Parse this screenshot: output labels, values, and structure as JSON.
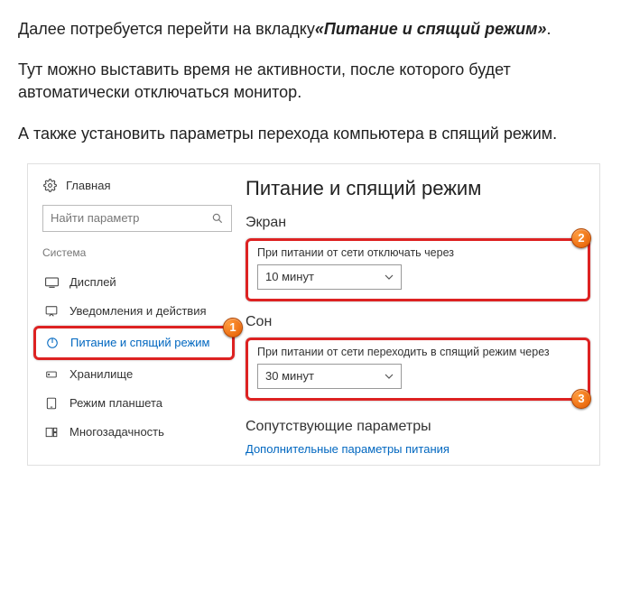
{
  "intro": {
    "p1_a": "Далее потребуется перейти на вкладку",
    "p1_b": "«Питание и спящий режим»",
    "p1_c": ".",
    "p2": "Тут можно выставить время не активности, после которого будет автоматически отключаться монитор.",
    "p3": "А также установить параметры перехода компьютера в спящий режим."
  },
  "sidebar": {
    "home": "Главная",
    "search_placeholder": "Найти параметр",
    "category": "Система",
    "items": [
      {
        "label": "Дисплей"
      },
      {
        "label": "Уведомления и действия"
      },
      {
        "label": "Питание и спящий режим"
      },
      {
        "label": "Хранилище"
      },
      {
        "label": "Режим планшета"
      },
      {
        "label": "Многозадачность"
      }
    ]
  },
  "content": {
    "title": "Питание и спящий режим",
    "screen": {
      "heading": "Экран",
      "label": "При питании от сети отключать через",
      "value": "10 минут"
    },
    "sleep": {
      "heading": "Сон",
      "label": "При питании от сети переходить в спящий режим через",
      "value": "30 минут"
    },
    "related": {
      "heading": "Сопутствующие параметры",
      "link": "Дополнительные параметры питания"
    }
  },
  "badges": {
    "b1": "1",
    "b2": "2",
    "b3": "3"
  }
}
